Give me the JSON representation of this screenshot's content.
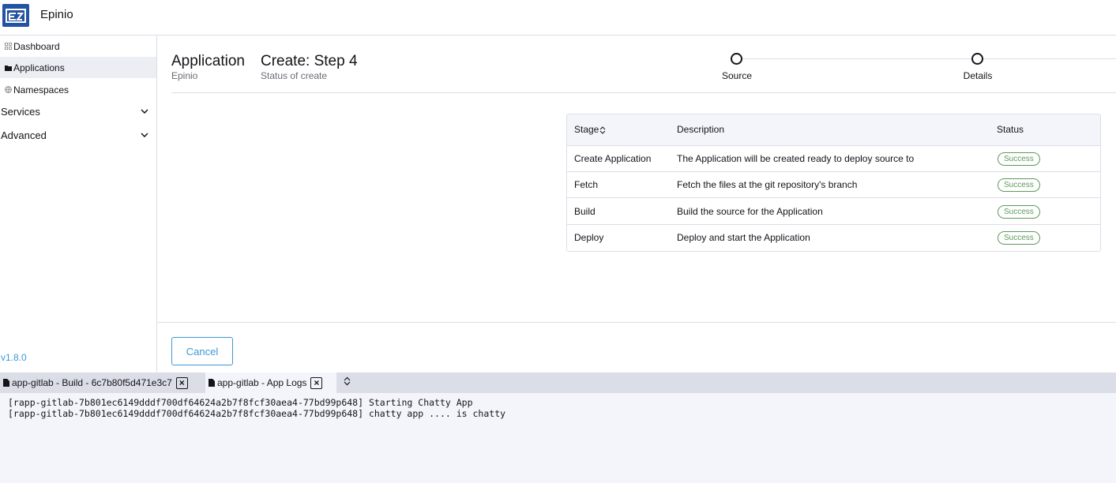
{
  "header": {
    "app_name": "Epinio",
    "logo_icon": "epinio-logo-icon"
  },
  "sidebar": {
    "items": [
      {
        "label": "Dashboard",
        "icon": "dashboard-icon"
      },
      {
        "label": "Applications",
        "icon": "folder-icon",
        "active": true
      },
      {
        "label": "Namespaces",
        "icon": "globe-icon"
      }
    ],
    "groups": [
      {
        "label": "Services",
        "icon": "chevron-down-icon"
      },
      {
        "label": "Advanced",
        "icon": "chevron-down-icon"
      }
    ],
    "version": "v1.8.0"
  },
  "main": {
    "title": "Application",
    "subtitle": "Epinio",
    "step_title": "Create: Step 4",
    "step_subtitle": "Status of create",
    "stepper": [
      {
        "label": "Source"
      },
      {
        "label": "Details"
      }
    ],
    "table": {
      "headers": {
        "stage": "Stage",
        "description": "Description",
        "status": "Status"
      },
      "rows": [
        {
          "stage": "Create Application",
          "description": "The Application will be created ready to deploy source to",
          "status": "Success"
        },
        {
          "stage": "Fetch",
          "description": "Fetch the files at the git repository's branch",
          "status": "Success"
        },
        {
          "stage": "Build",
          "description": "Build the source for the Application",
          "status": "Success"
        },
        {
          "stage": "Deploy",
          "description": "Deploy and start the Application",
          "status": "Success"
        }
      ]
    },
    "cancel_label": "Cancel"
  },
  "bottom_panel": {
    "tabs": [
      {
        "label": "app-gitlab - Build - 6c7b80f5d471e3c7",
        "active": false
      },
      {
        "label": "app-gitlab - App Logs",
        "active": true
      }
    ],
    "logs": [
      "[rapp-gitlab-7b801ec6149dddf700df64624a2b7f8fcf30aea4-77bd99p648] Starting Chatty App",
      "[rapp-gitlab-7b801ec6149dddf700df64624a2b7f8fcf30aea4-77bd99p648] chatty app .... is chatty"
    ]
  },
  "colors": {
    "accent": "#3d98d3",
    "brand": "#2453a3",
    "success": "#5d995d",
    "border": "#dcdee7"
  }
}
